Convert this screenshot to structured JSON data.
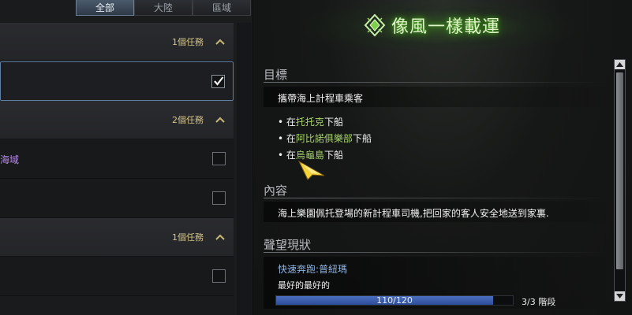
{
  "filter_tabs": [
    {
      "label": "全部",
      "active": true
    },
    {
      "label": "大陸",
      "active": false
    },
    {
      "label": "區域",
      "active": false
    }
  ],
  "quest_groups": [
    {
      "count_label": "1個任務",
      "rows": [
        {
          "text": "",
          "checked": true,
          "selected": true
        }
      ]
    },
    {
      "count_label": "2個任務",
      "rows": [
        {
          "text": "海域",
          "checked": false,
          "selected": false
        },
        {
          "text": "",
          "checked": false,
          "selected": false
        }
      ]
    },
    {
      "count_label": "1個任務",
      "rows": [
        {
          "text": "",
          "checked": false,
          "selected": false
        }
      ]
    }
  ],
  "quest_title": "像風一樣載運",
  "sections": {
    "objective": {
      "title": "目標",
      "summary": "攜帶海上計程車乘客",
      "bullets": [
        {
          "prefix": "在",
          "highlight": "托托克",
          "suffix": "下船"
        },
        {
          "prefix": "在",
          "highlight": "阿比諾俱樂部",
          "suffix": "下船"
        },
        {
          "prefix": "在",
          "highlight": "烏龜島",
          "suffix": "下船"
        }
      ]
    },
    "content": {
      "title": "內容",
      "text": "海上樂園佩托登場的新計程車司機,把回家的客人安全地送到家裏."
    },
    "reputation": {
      "title": "聲望現狀",
      "name": "快速奔跑:普紐瑪",
      "level": "最好的最好的",
      "progress_text": "110/120",
      "progress_fraction": 0.9167,
      "stage_text": "3/3 階段"
    }
  },
  "colors": {
    "highlight_green": "#a6d36b",
    "title_glow": "#4caf1f",
    "progress_blue": "#4b6fbf",
    "purple_text": "#b48be0",
    "group_count_gold": "#d4c48a"
  }
}
